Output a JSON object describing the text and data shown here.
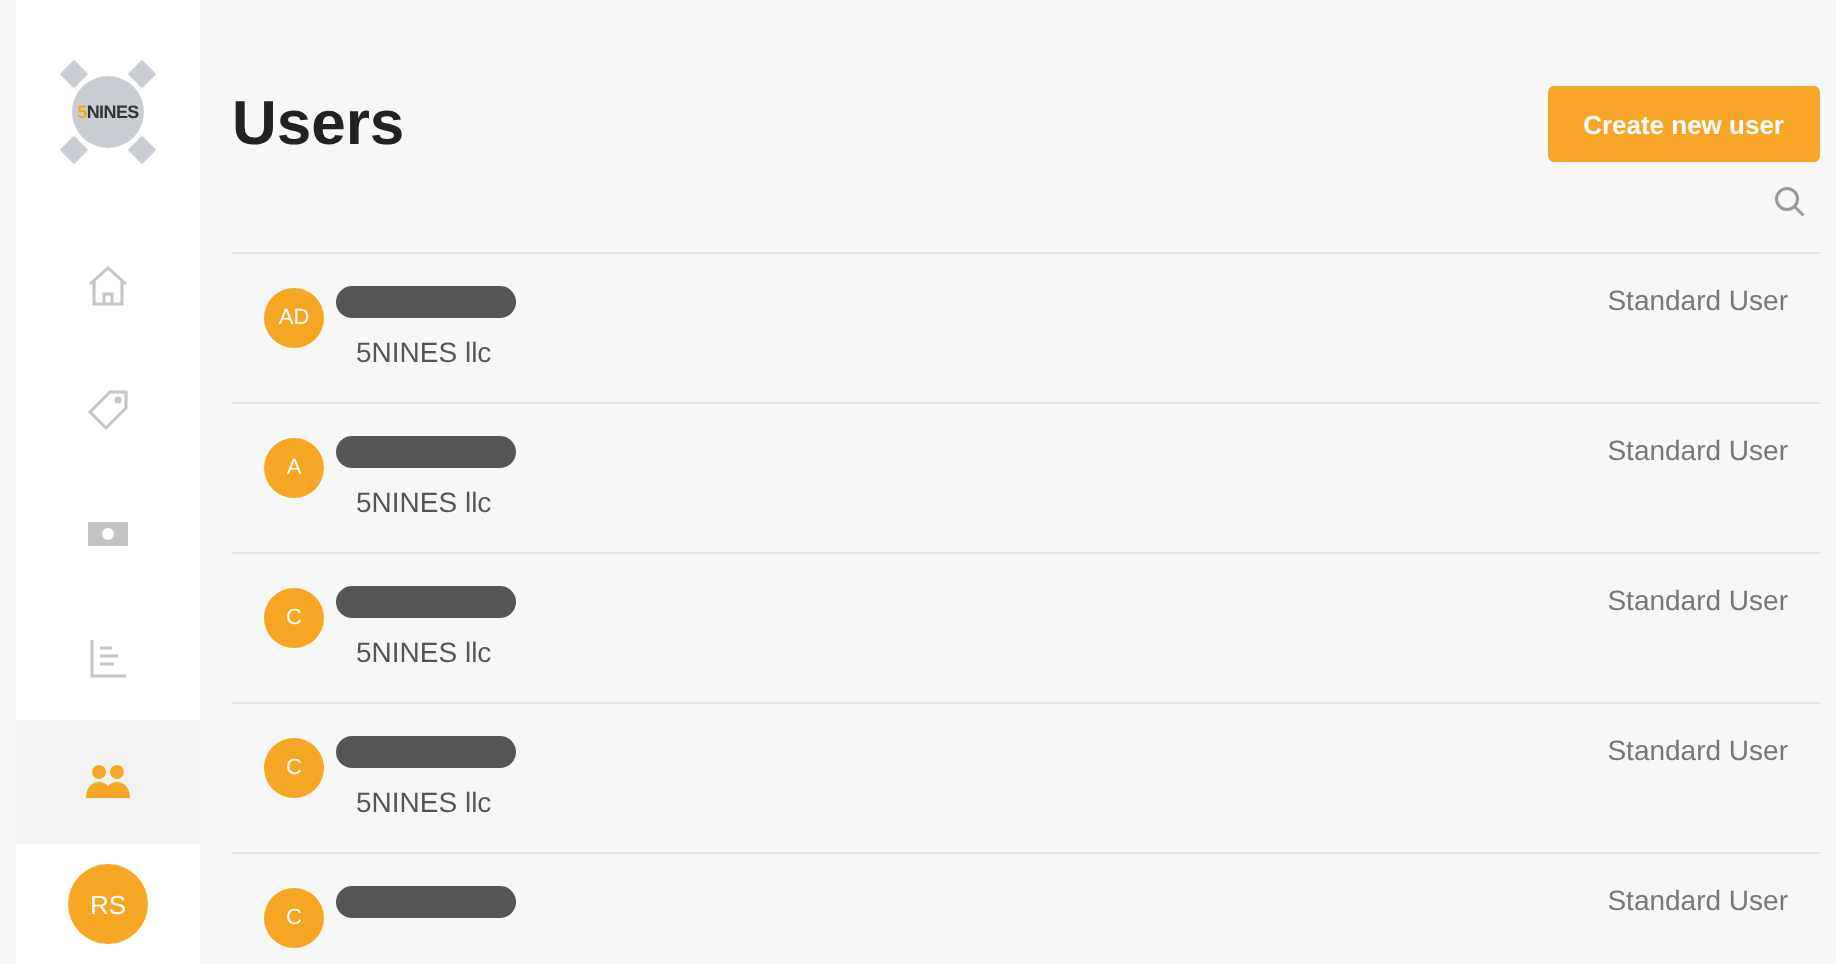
{
  "logo": {
    "accent": "5",
    "text": "NINES"
  },
  "sidebar": {
    "items": [
      {
        "kind": "home",
        "selected": false
      },
      {
        "kind": "tag",
        "selected": false
      },
      {
        "kind": "money",
        "selected": false
      },
      {
        "kind": "report",
        "selected": false
      },
      {
        "kind": "users",
        "selected": true
      }
    ],
    "profile": {
      "initials": "RS"
    }
  },
  "title": "Users",
  "create_button": "Create new user",
  "users": [
    {
      "initials": "AD",
      "company": "5NINES llc",
      "role": "Standard User"
    },
    {
      "initials": "A",
      "company": "5NINES llc",
      "role": "Standard User"
    },
    {
      "initials": "C",
      "company": "5NINES llc",
      "role": "Standard User"
    },
    {
      "initials": "C",
      "company": "5NINES llc",
      "role": "Standard User"
    },
    {
      "initials": "C",
      "role": "Standard User"
    }
  ]
}
